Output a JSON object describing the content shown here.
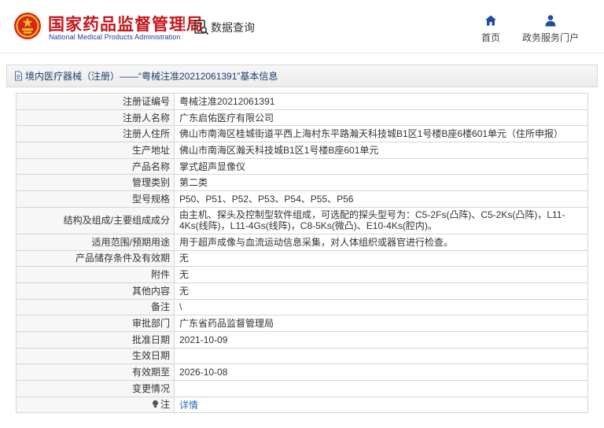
{
  "header": {
    "org_name": "国家药品监督管理局",
    "org_name_en": "National Medical Products Administration",
    "query_label": "数据查询",
    "nav": [
      {
        "label": "首页",
        "icon": "home-icon"
      },
      {
        "label": "政务服务门户",
        "icon": "user-icon"
      }
    ]
  },
  "breadcrumb": {
    "text": "境内医疗器械（注册）——“粤械注准20212061391”基本信息",
    "icon": "document-icon"
  },
  "record": {
    "fields": [
      {
        "label": "注册证编号",
        "value": "粤械注准20212061391"
      },
      {
        "label": "注册人名称",
        "value": "广东启佑医疗有限公司"
      },
      {
        "label": "注册人住所",
        "value": "佛山市南海区桂城街道平西上海村东平路瀚天科技城B1区1号楼B座6楼601单元（住所申报）"
      },
      {
        "label": "生产地址",
        "value": "佛山市南海区瀚天科技城B1区1号楼B座601单元"
      },
      {
        "label": "产品名称",
        "value": "掌式超声显像仪"
      },
      {
        "label": "管理类别",
        "value": "第二类"
      },
      {
        "label": "型号规格",
        "value": "P50、P51、P52、P53、P54、P55、P56"
      },
      {
        "label": "结构及组成/主要组成成分",
        "value": "由主机、探头及控制型软件组成，可选配的探头型号为：C5-2Fs(凸阵)、C5-2Ks(凸阵)，L11-4Ks(线阵)，L11-4Gs(线阵)，C8-5Ks(微凸)、E10-4Ks(腔内)。"
      },
      {
        "label": "适用范围/预期用途",
        "value": "用于超声成像与血流运动信息采集，对人体组织或器官进行检查。"
      },
      {
        "label": "产品储存条件及有效期",
        "value": "无"
      },
      {
        "label": "附件",
        "value": "无"
      },
      {
        "label": "其他内容",
        "value": "无"
      },
      {
        "label": "备注",
        "value": "\\"
      },
      {
        "label": "审批部门",
        "value": "广东省药品监督管理局"
      },
      {
        "label": "批准日期",
        "value": "2021-10-09"
      },
      {
        "label": "生效日期",
        "value": ""
      },
      {
        "label": "有效期至",
        "value": "2026-10-08"
      },
      {
        "label": "变更情况",
        "value": ""
      }
    ],
    "note_label": "注",
    "note_link": "详情"
  },
  "colors": {
    "brand_red": "#c4161c",
    "brand_blue": "#1a3d8f",
    "link_blue": "#2a6ebb"
  }
}
